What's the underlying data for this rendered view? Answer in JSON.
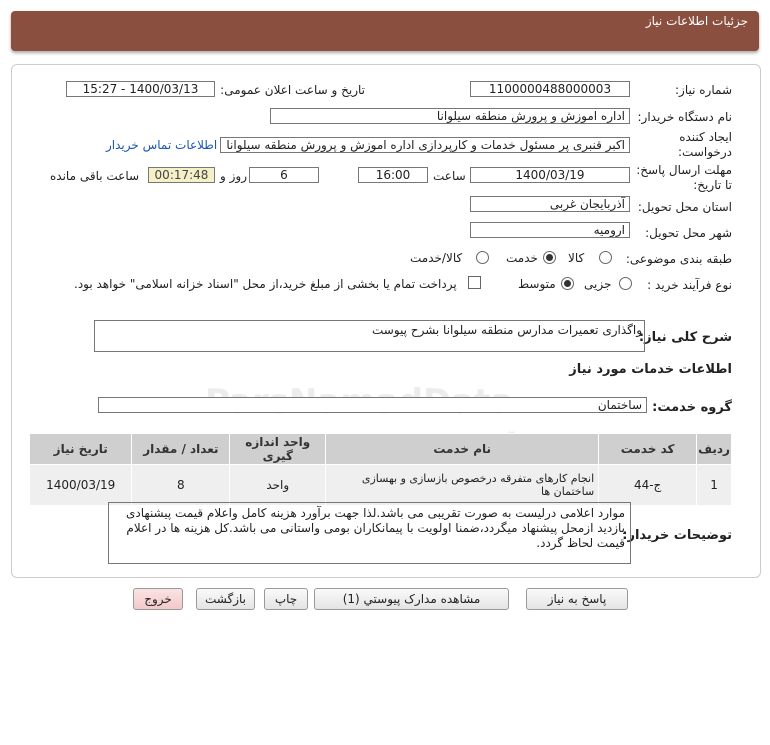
{
  "header": {
    "title": "جزئیات اطلاعات نیاز"
  },
  "form": {
    "need_number_label": "شماره نیاز:",
    "need_number": "1100000488000003",
    "announce_label": "تاریخ و ساعت اعلان عمومی:",
    "announce_value": "1400/03/13 - 15:27",
    "buyer_org_label": "نام دستگاه خریدار:",
    "buyer_org": "اداره اموزش و پرورش منطقه سیلوانا",
    "creator_label_1": "ایجاد کننده",
    "creator_label_2": "درخواست:",
    "creator": "اکبر قنبری پر مسئول خدمات و کارپردازی اداره اموزش و پرورش منطقه سیلوانا",
    "contact_link": "اطلاعات تماس خریدار",
    "deadline_label_1": "مهلت ارسال پاسخ:",
    "deadline_label_2": "تا تاریخ:",
    "deadline_date": "1400/03/19",
    "time_label": "ساعت",
    "deadline_time": "16:00",
    "days_value": "6",
    "days_label": "روز و",
    "remaining_time": "00:17:48",
    "remaining_label": "ساعت باقی مانده",
    "province_label": "استان محل تحویل:",
    "province": "آذربایجان غربی",
    "city_label": "شهر محل تحویل:",
    "city": "ارومیه",
    "category_label": "طبقه بندی موضوعی:",
    "category_options": [
      "کالا",
      "خدمت",
      "کالا/خدمت"
    ],
    "process_label": "نوع فرآیند خرید :",
    "process_options": [
      "جزیی",
      "متوسط"
    ],
    "payment_note": "پرداخت تمام یا بخشی از مبلغ خرید،از محل \"اسناد خزانه اسلامی\" خواهد بود."
  },
  "summary": {
    "label": "شرح کلی نیاز:",
    "value": "واگذاری تعمیرات مدارس منطقه سیلوانا بشرح پیوست"
  },
  "services_section": {
    "title": "اطلاعات خدمات مورد نیاز",
    "group_label": "گروه خدمت:",
    "group_value": "ساختمان"
  },
  "table": {
    "headers": [
      "ردیف",
      "کد خدمت",
      "نام خدمت",
      "واحد اندازه گیری",
      "تعداد / مقدار",
      "تاریخ نیاز"
    ],
    "rows": [
      [
        "1",
        "ج-44",
        "انجام کارهای متفرقه درخصوص بازسازی و بهسازی ساختمان ها",
        "واحد",
        "8",
        "1400/03/19"
      ]
    ]
  },
  "buyer_notes": {
    "label": "توضیحات خریدار:",
    "text": "موارد اعلامی درلیست به صورت تقریبی می باشد.لذا جهت برآورد هزینه کامل واعلام قیمت پیشنهادی بازدید ازمحل پیشنهاد میگردد،ضمنا اولویت با پیمانکاران بومی واستانی می باشد.کل  هزینه ها در اعلام قیمت لحاظ گردد."
  },
  "buttons": {
    "reply": "پاسخ به نیاز",
    "attachments": "مشاهده مدارک پیوستي (1)",
    "print": "چاپ",
    "back": "بازگشت",
    "exit": "خروج"
  },
  "watermark": {
    "line1": "ParsNamadData",
    "line2": "مرکز فراهم آوری و ارائه اطلاعات مناقصات و مزایده",
    "line3": "پایگاه اطلاع رسانی مناقصه ومزایده"
  }
}
